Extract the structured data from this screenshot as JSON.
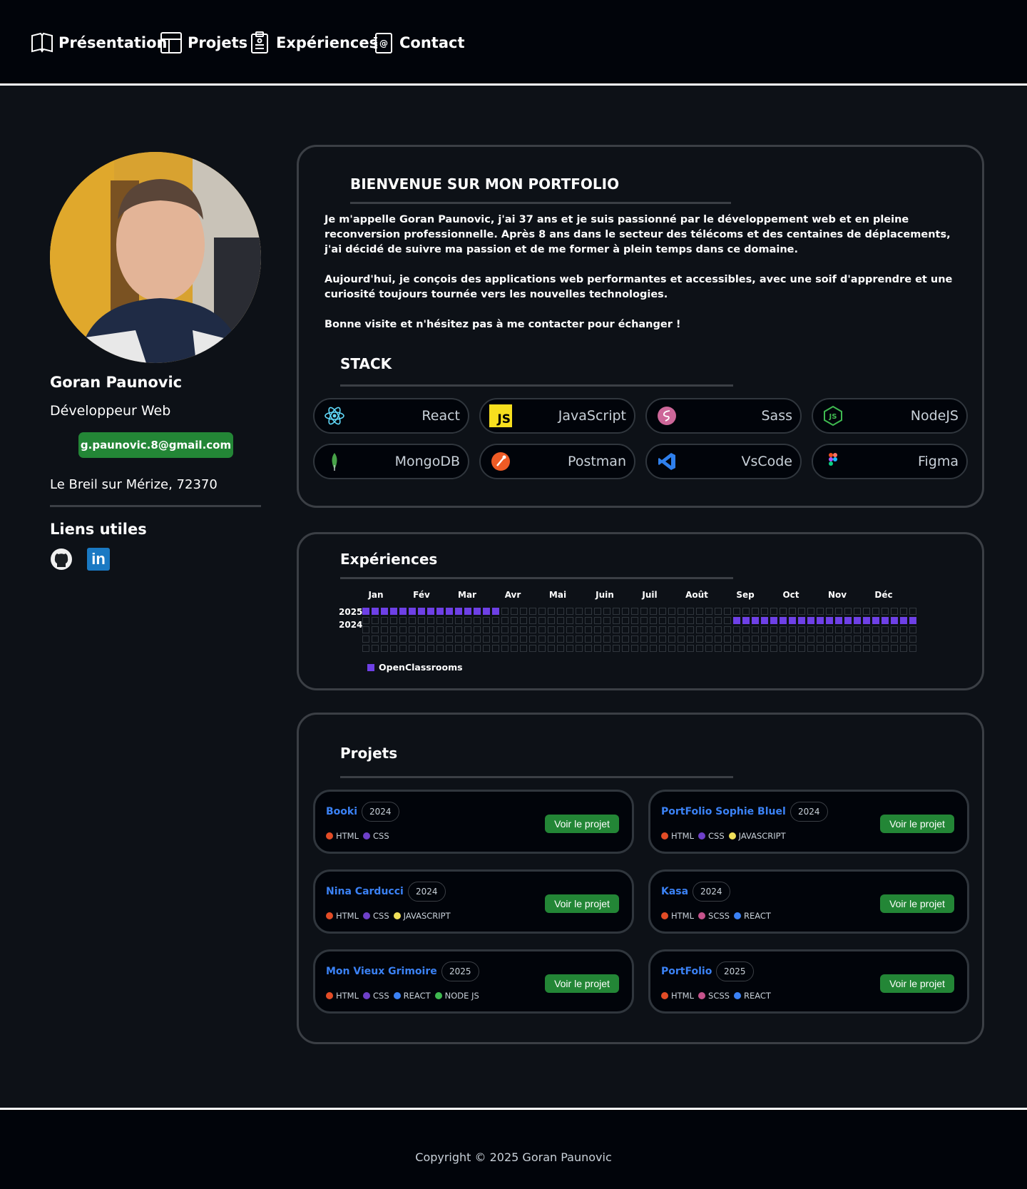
{
  "nav": {
    "items": [
      {
        "label": "Présentation",
        "icon": "book-icon"
      },
      {
        "label": "Projets",
        "icon": "layout-icon"
      },
      {
        "label": "Expériences",
        "icon": "clipboard-icon"
      },
      {
        "label": "Contact",
        "icon": "contact-icon"
      }
    ]
  },
  "profile": {
    "name": "Goran Paunovic",
    "role": "Développeur Web",
    "email": "g.paunovic.8@gmail.com",
    "location": "Le Breil sur Mérize, 72370",
    "links_title": "Liens utiles",
    "linkedin_label": "in"
  },
  "intro": {
    "title": "BIENVENUE SUR MON PORTFOLIO",
    "paragraphs": [
      "Je m'appelle Goran Paunovic, j'ai 37 ans et je suis passionné par le développement web et en pleine reconversion professionnelle. Après 8 ans dans le secteur des télécoms et des centaines de déplacements, j'ai décidé de suivre ma passion et de me former à plein temps dans ce domaine.",
      "Aujourd'hui, je conçois des applications web performantes et accessibles, avec une soif d'apprendre et une curiosité toujours tournée vers les nouvelles technologies.",
      "Bonne visite et n'hésitez pas à me contacter pour échanger !"
    ]
  },
  "stack": {
    "title": "STACK",
    "items": [
      {
        "label": "React",
        "icon": "react-icon"
      },
      {
        "label": "JavaScript",
        "icon": "javascript-icon",
        "icon_text": "JS"
      },
      {
        "label": "Sass",
        "icon": "sass-icon"
      },
      {
        "label": "NodeJS",
        "icon": "nodejs-icon"
      },
      {
        "label": "MongoDB",
        "icon": "mongodb-icon"
      },
      {
        "label": "Postman",
        "icon": "postman-icon"
      },
      {
        "label": "VsCode",
        "icon": "vscode-icon"
      },
      {
        "label": "Figma",
        "icon": "figma-icon"
      }
    ]
  },
  "experiences": {
    "title": "Expériences",
    "months": [
      "Jan",
      "Fév",
      "Mar",
      "Avr",
      "Mai",
      "Juin",
      "Juil",
      "Août",
      "Sep",
      "Oct",
      "Nov",
      "Déc"
    ],
    "years": [
      "2025",
      "2024"
    ],
    "legend": "OpenClassrooms",
    "highlight_color": "#6e40e6"
  },
  "projects": {
    "title": "Projets",
    "button_label": "Voir le projet",
    "items": [
      {
        "name": "Booki",
        "year": "2024",
        "tags": [
          {
            "label": "HTML",
            "color": "#e34c26"
          },
          {
            "label": "CSS",
            "color": "#6e40c9"
          }
        ]
      },
      {
        "name": "PortFolio Sophie Bluel",
        "year": "2024",
        "tags": [
          {
            "label": "HTML",
            "color": "#e34c26"
          },
          {
            "label": "CSS",
            "color": "#6e40c9"
          },
          {
            "label": "JAVASCRIPT",
            "color": "#f1e05a"
          }
        ]
      },
      {
        "name": "Nina Carducci",
        "year": "2024",
        "tags": [
          {
            "label": "HTML",
            "color": "#e34c26"
          },
          {
            "label": "CSS",
            "color": "#6e40c9"
          },
          {
            "label": "JAVASCRIPT",
            "color": "#f1e05a"
          }
        ]
      },
      {
        "name": "Kasa",
        "year": "2024",
        "tags": [
          {
            "label": "HTML",
            "color": "#e34c26"
          },
          {
            "label": "SCSS",
            "color": "#c6538c"
          },
          {
            "label": "REACT",
            "color": "#3b82f6"
          }
        ]
      },
      {
        "name": "Mon Vieux Grimoire",
        "year": "2025",
        "tags": [
          {
            "label": "HTML",
            "color": "#e34c26"
          },
          {
            "label": "CSS",
            "color": "#6e40c9"
          },
          {
            "label": "REACT",
            "color": "#3b82f6"
          },
          {
            "label": "NODE JS",
            "color": "#3fb950"
          }
        ]
      },
      {
        "name": "PortFolio",
        "year": "2025",
        "tags": [
          {
            "label": "HTML",
            "color": "#e34c26"
          },
          {
            "label": "SCSS",
            "color": "#c6538c"
          },
          {
            "label": "REACT",
            "color": "#3b82f6"
          }
        ]
      }
    ]
  },
  "footer": {
    "copyright": "Copyright © 2025 Goran Paunovic"
  },
  "colors": {
    "background": "#0d1117",
    "header": "#01040a",
    "accent_green": "#238636",
    "link_blue": "#3b82f6"
  }
}
